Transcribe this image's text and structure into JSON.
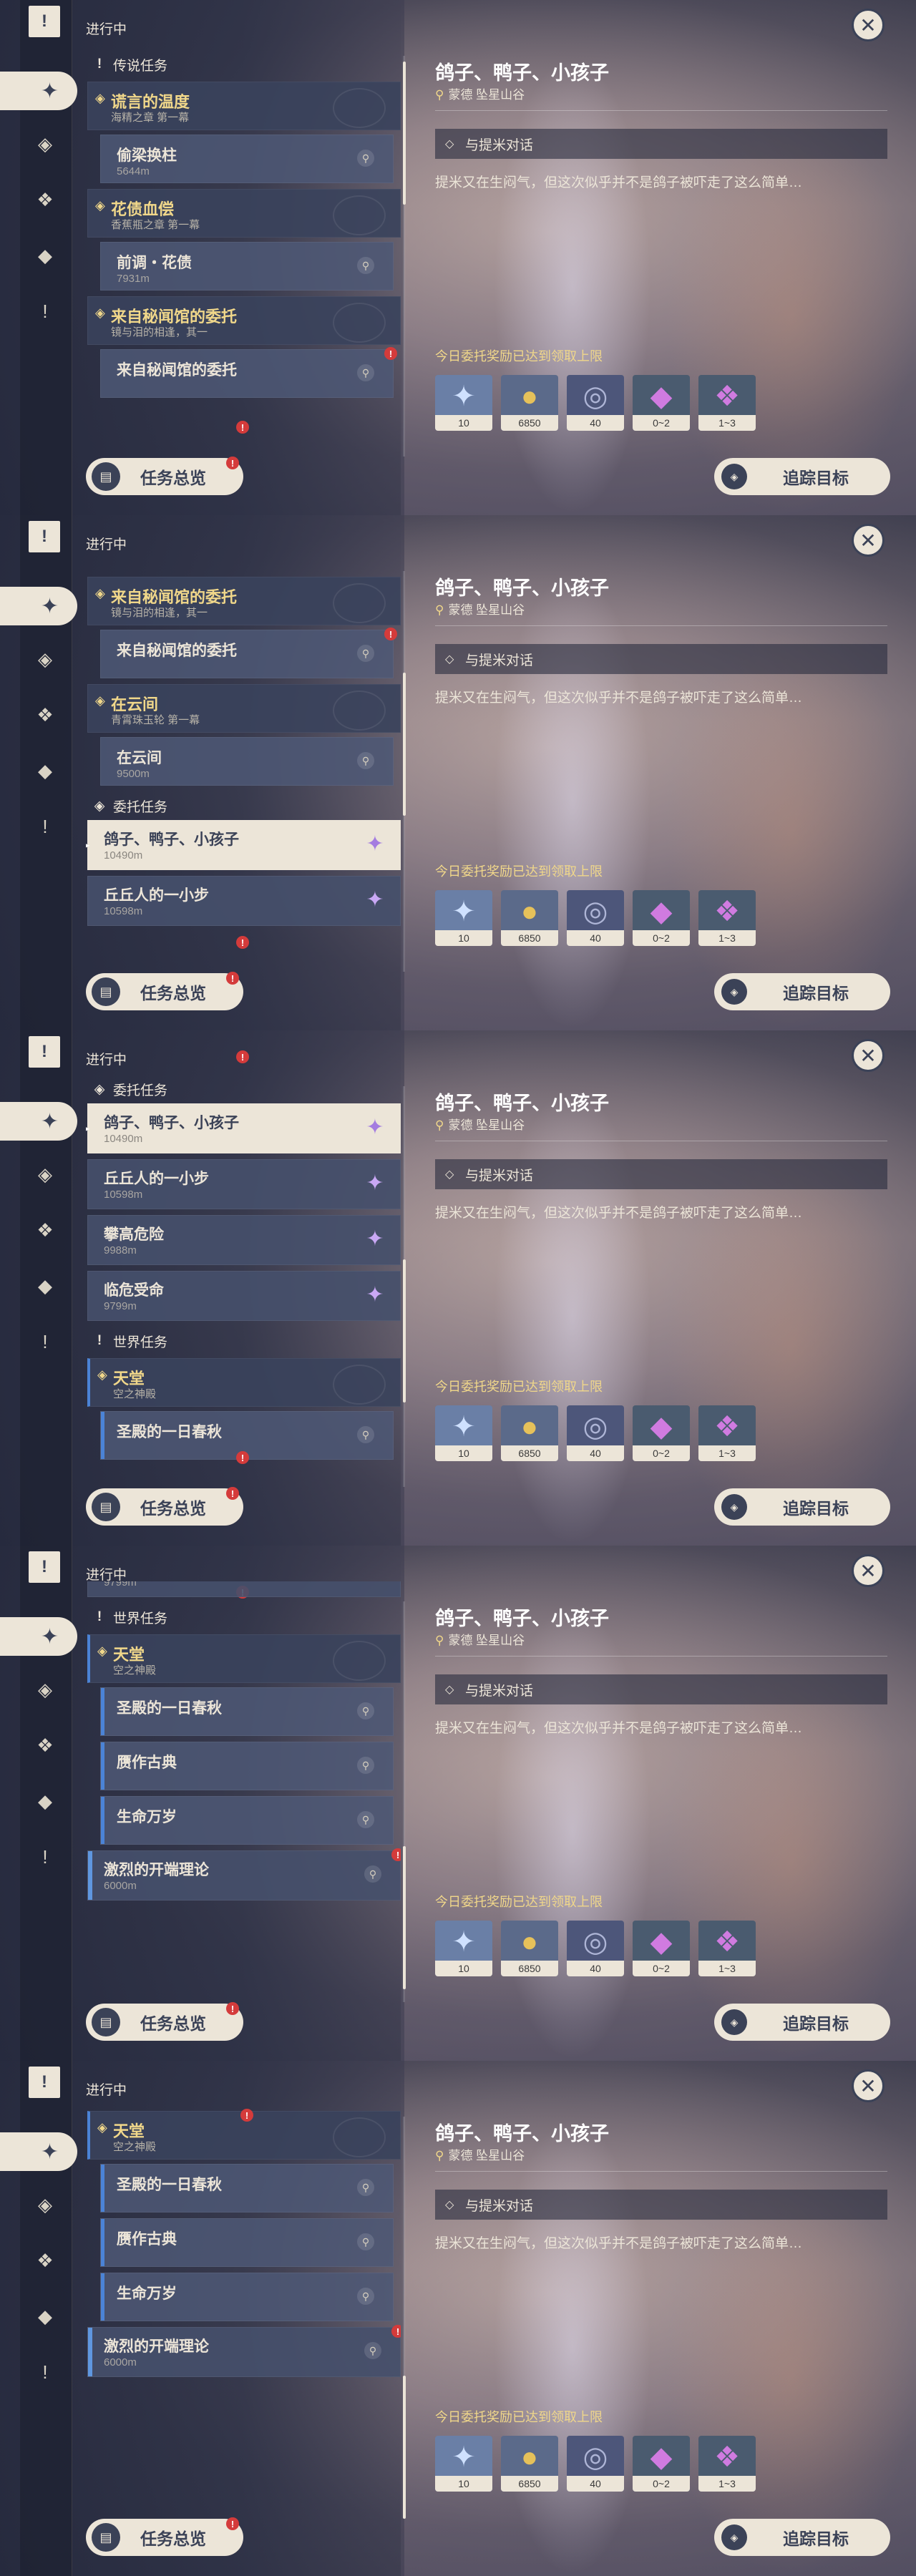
{
  "header": {
    "ongoing": "进行中"
  },
  "rail": {
    "top_icon": "quest-book-icon",
    "icons": [
      "all-quests-icon",
      "archon-quests-icon",
      "story-quests-icon",
      "commission-icon",
      "world-quests-icon"
    ]
  },
  "detail": {
    "title": "鸽子、鸭子、小孩子",
    "location": "蒙德 坠星山谷",
    "objective": "与提米对话",
    "description": "提米又在生闷气，但这次似乎并不是鸽子被吓走了这么简单…",
    "reward_note": "今日委托奖励已达到领取上限",
    "rewards": [
      {
        "icon": "adventure-exp-icon",
        "count": "10",
        "color": "#7f9ec9"
      },
      {
        "icon": "mora-icon",
        "count": "6850",
        "color": "#c9a24d"
      },
      {
        "icon": "companionship-exp-icon",
        "count": "40",
        "color": "#6b6f8f"
      },
      {
        "icon": "crystal-icon",
        "count": "0~2",
        "color": "#b066c6"
      },
      {
        "icon": "crystal-cluster-icon",
        "count": "1~3",
        "color": "#b066c6"
      }
    ]
  },
  "buttons": {
    "overview": "任务总览",
    "track": "追踪目标"
  },
  "categories": {
    "legend": "传说任务",
    "commission": "委托任务",
    "world": "世界任务"
  },
  "quests": {
    "q1": {
      "title": "谎言的温度",
      "sub": "海精之章 第一幕"
    },
    "q1s": {
      "title": "偷梁换柱",
      "dist": "5644m"
    },
    "q2": {
      "title": "花债血偿",
      "sub": "香蕉瓶之章 第一幕"
    },
    "q2s": {
      "title": "前调・花债",
      "dist": "7931m"
    },
    "q3": {
      "title": "来自秘闻馆的委托",
      "sub": "镜与泪的相逢，其一"
    },
    "q3s": {
      "title": "来自秘闻馆的委托"
    },
    "q4": {
      "title": "在云间",
      "sub": "青霄珠玉轮 第一幕"
    },
    "q4s": {
      "title": "在云间",
      "dist": "9500m"
    },
    "c1": {
      "title": "鸽子、鸭子、小孩子",
      "dist": "10490m"
    },
    "c2": {
      "title": "丘丘人的一小步",
      "dist": "10598m"
    },
    "c3": {
      "title": "攀高危险",
      "dist": "9988m"
    },
    "c4": {
      "title": "临危受命",
      "dist": "9799m"
    },
    "w1": {
      "title": "天堂",
      "sub": "空之神殿"
    },
    "w1s1": {
      "title": "圣殿的一日春秋"
    },
    "w1s2": {
      "title": "赝作古典"
    },
    "w1s3": {
      "title": "生命万岁"
    },
    "w2": {
      "title": "激烈的开端理论",
      "dist": "6000m"
    }
  },
  "colors": {
    "gold": "#f0d78a",
    "cream": "#ece5d8",
    "navy": "#3b4257",
    "badge": "#d43b3b",
    "world_blue": "#4b83d6"
  }
}
